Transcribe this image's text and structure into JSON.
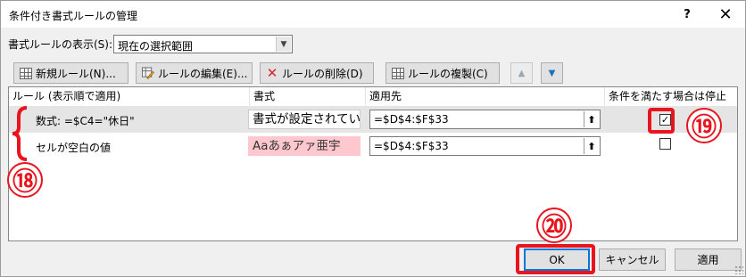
{
  "window": {
    "title": "条件付き書式ルールの管理",
    "help_label": "?",
    "close_label": "✕"
  },
  "show_rules": {
    "label": "書式ルールの表示(S):",
    "selected": "現在の選択範囲"
  },
  "toolbar": {
    "new_rule": "新規ルール(N)...",
    "edit_rule": "ルールの編集(E)...",
    "delete_rule": "ルールの削除(D)",
    "duplicate_rule": "ルールの複製(C)",
    "move_up": "▲",
    "move_down": "▼"
  },
  "table": {
    "headers": [
      "ルール (表示順で適用)",
      "書式",
      "適用先",
      "条件を満たす場合は停止"
    ],
    "rows": [
      {
        "rule": "数式: =$C4=\"休日\"",
        "format_preview": "書式が設定されてい",
        "applies_to": "=$D$4:$F$33",
        "stop_if_true": true,
        "stop_mark": "✓"
      },
      {
        "rule": "セルが空白の値",
        "format_preview": "Aaあぁアァ亜宇",
        "applies_to": "=$D$4:$F$33",
        "stop_if_true": false,
        "stop_mark": ""
      }
    ],
    "range_picker_icon": "⬆"
  },
  "footer": {
    "ok": "OK",
    "cancel": "キャンセル",
    "apply": "適用"
  },
  "annotations": {
    "n18": "⑱",
    "n19": "⑲",
    "n20": "⑳"
  },
  "colors": {
    "highlight_red": "#e8141e",
    "selected_row": "#e5e5e5",
    "format_pink": "#ffc7ce",
    "ok_border": "#0078d7"
  }
}
